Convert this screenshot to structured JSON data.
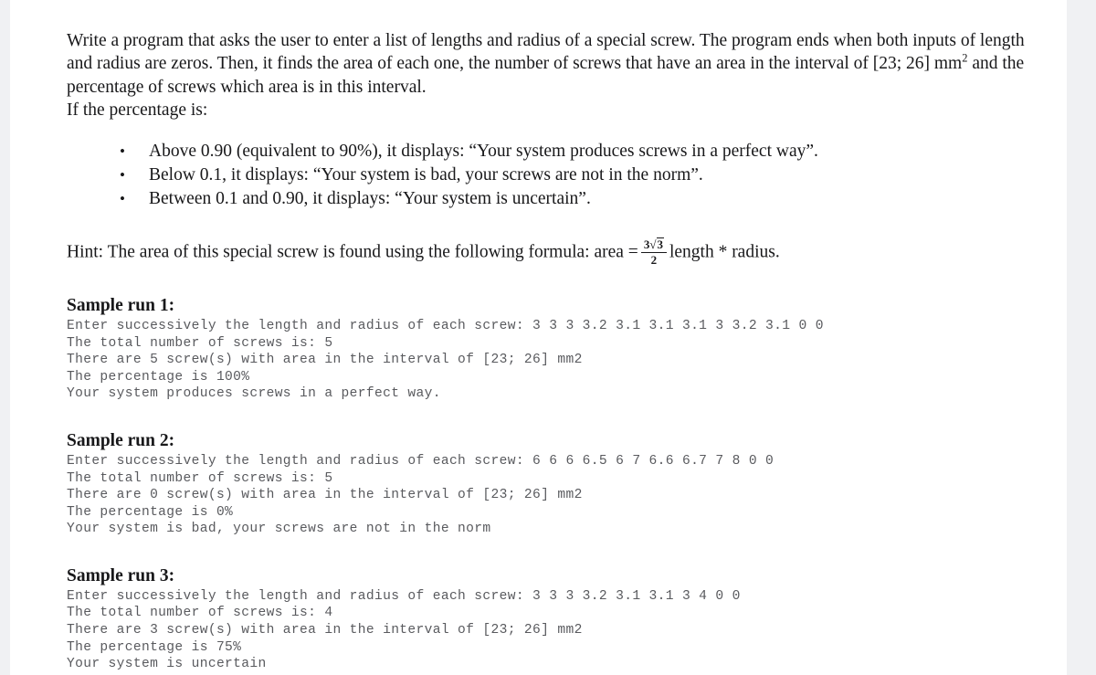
{
  "document": {
    "statement_paragraph": "Write a program that asks the user to enter a list of lengths and radius of a special screw. The program ends when both inputs of length and radius are zeros. Then, it finds the area of each one, the number of screws that have an area in the interval of [23; 26] mm",
    "statement_superscript": "2",
    "statement_paragraph_tail": " and the percentage of screws which area is in this interval.",
    "condition_lead": "If the percentage is:",
    "bullet_marker": "•",
    "bullets": [
      "Above 0.90 (equivalent to 90%), it displays: “Your system produces screws in a perfect way”.",
      "Below 0.1, it displays: “Your system is bad, your screws are not in the norm”.",
      "Between 0.1 and 0.90, it displays: “Your system is uncertain”."
    ],
    "hint": {
      "lead": "Hint: The area of this special screw is found using the following formula: area =",
      "formula_numerator_coefficient": "3",
      "formula_numerator_radical": "√",
      "formula_numerator_radicand": "3",
      "formula_denominator": "2",
      "trail": "length * radius."
    },
    "sample_runs": [
      {
        "title": "Sample run 1:",
        "lines": [
          "Enter successively the length and radius of each screw: 3 3 3 3.2 3.1 3.1 3.1 3 3.2 3.1 0 0",
          "The total number of screws is: 5",
          "There are 5 screw(s) with area in the interval of [23; 26] mm2",
          "The percentage is 100%",
          "Your system produces screws in a perfect way."
        ]
      },
      {
        "title": "Sample run 2:",
        "lines": [
          "Enter successively the length and radius of each screw: 6 6 6 6.5 6 7 6.6 6.7 7 8 0 0",
          "The total number of screws is: 5",
          "There are 0 screw(s) with area in the interval of [23; 26] mm2",
          "The percentage is 0%",
          "Your system is bad, your screws are not in the norm"
        ]
      },
      {
        "title": "Sample run 3:",
        "lines": [
          "Enter successively the length and radius of each screw: 3 3 3 3.2 3.1 3.1 3 4 0 0",
          "The total number of screws is: 4",
          "There are 3 screw(s) with area in the interval of [23; 26] mm2",
          "The percentage is 75%",
          "Your system is uncertain"
        ]
      }
    ],
    "colors": {
      "page_background": "#f0f1f3",
      "paper": "#ffffff",
      "body_text": "#18181a",
      "console_text": "#595a5e"
    }
  }
}
